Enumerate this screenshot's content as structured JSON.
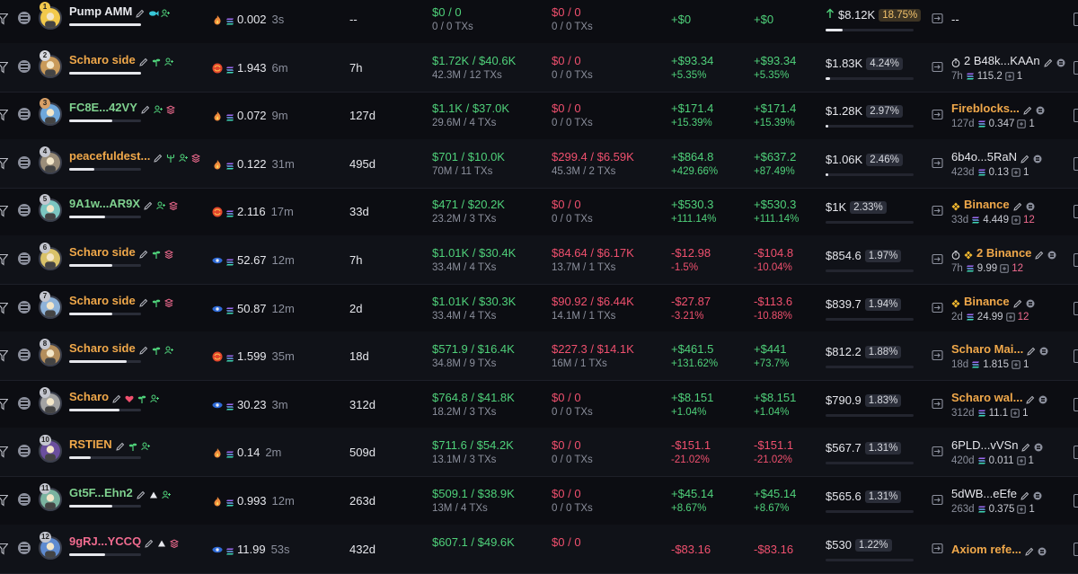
{
  "colors": {
    "background": "#0c0d12",
    "alt_row": "#101218",
    "profit": "#4fd17a",
    "loss": "#f0506e",
    "name_orange": "#f0a84a",
    "name_green": "#7fd18f",
    "highlight_pill": "#f2c26b"
  },
  "rows": [
    {
      "rank": "1",
      "rank_style": "gold",
      "name": "Pump AMM",
      "name_color": "white",
      "name_progress": 1.0,
      "icons": [
        "edit-icon",
        "fish-icon",
        "user-add-icon"
      ],
      "balance": "0.002",
      "balance_age": "3s",
      "source_icon": "fire-icon",
      "held": "--",
      "bought_usd": "$0",
      "bought_total": "0",
      "bought_sub": "0 / 0 TXs",
      "bought_color": "green",
      "sold_usd": "$0",
      "sold_total": "0",
      "sold_sub": "0 / 0 TXs",
      "pnl": "+$0",
      "pnl_pct": "",
      "pnl_color": "green",
      "upnl": "+$0",
      "upnl_pct": "",
      "upnl_color": "green",
      "remaining": "$8.12K",
      "remaining_pct": "18.75%",
      "remaining_highlight": true,
      "remaining_fill": 0.19,
      "remaining_up_arrow": true,
      "funding_name": "--",
      "funding_style": "white",
      "funding_age": "",
      "funding_amount": "",
      "funding_count": ""
    },
    {
      "rank": "2",
      "rank_style": "silver",
      "name": "Scharo side",
      "name_color": "orange",
      "name_progress": 1.0,
      "icons": [
        "edit-icon",
        "plant-icon",
        "user-add-icon"
      ],
      "balance": "1.943",
      "balance_age": "6m",
      "source_icon": "swap-icon",
      "held": "7h",
      "bought_usd": "$1.72K",
      "bought_total": "$40.6K",
      "bought_sub": "42.3M / 12 TXs",
      "sold_usd": "$0",
      "sold_total": "0",
      "sold_sub": "0 / 0 TXs",
      "pnl": "+$93.34",
      "pnl_pct": "+5.35%",
      "pnl_color": "green",
      "upnl": "+$93.34",
      "upnl_pct": "+5.35%",
      "upnl_color": "green",
      "remaining": "$1.83K",
      "remaining_pct": "4.24%",
      "remaining_highlight": false,
      "remaining_fill": 0.05,
      "funding_name": "2 B48k...KAAn",
      "funding_style": "white",
      "funding_timer": true,
      "funding_age": "7h",
      "funding_amount": "115.2",
      "funding_count": "1"
    },
    {
      "rank": "3",
      "rank_style": "bronze",
      "name": "FC8E...42VY",
      "name_color": "green",
      "name_progress": 0.6,
      "icons": [
        "edit-icon",
        "user-add-icon",
        "stack-icon"
      ],
      "balance": "0.072",
      "balance_age": "9m",
      "source_icon": "fire-icon",
      "held": "127d",
      "bought_usd": "$1.1K",
      "bought_total": "$37.0K",
      "bought_sub": "29.6M / 4 TXs",
      "sold_usd": "$0",
      "sold_total": "0",
      "sold_sub": "0 / 0 TXs",
      "pnl": "+$171.4",
      "pnl_pct": "+15.39%",
      "pnl_color": "green",
      "upnl": "+$171.4",
      "upnl_pct": "+15.39%",
      "upnl_color": "green",
      "remaining": "$1.28K",
      "remaining_pct": "2.97%",
      "remaining_highlight": false,
      "remaining_fill": 0.03,
      "funding_name": "Fireblocks...",
      "funding_style": "orange",
      "funding_age": "127d",
      "funding_amount": "0.347",
      "funding_count": "1"
    },
    {
      "rank": "4",
      "rank_style": "",
      "name": "peacefuldest...",
      "name_color": "orange",
      "name_progress": 0.35,
      "icons": [
        "edit-icon",
        "trident-icon",
        "user-add-icon",
        "stack-icon"
      ],
      "balance": "0.122",
      "balance_age": "31m",
      "source_icon": "fire-icon",
      "held": "495d",
      "bought_usd": "$701",
      "bought_total": "$10.0K",
      "bought_sub": "70M / 11 TXs",
      "sold_usd": "$299.4",
      "sold_total": "$6.59K",
      "sold_sub": "45.3M / 2 TXs",
      "sold_active": true,
      "pnl": "+$864.8",
      "pnl_pct": "+429.66%",
      "pnl_color": "green",
      "upnl": "+$637.2",
      "upnl_pct": "+87.49%",
      "upnl_color": "green",
      "remaining": "$1.06K",
      "remaining_pct": "2.46%",
      "remaining_highlight": false,
      "remaining_fill": 0.03,
      "funding_name": "6b4o...5RaN",
      "funding_style": "white",
      "funding_age": "423d",
      "funding_amount": "0.13",
      "funding_count": "1"
    },
    {
      "rank": "5",
      "rank_style": "",
      "name": "9A1w...AR9X",
      "name_color": "green",
      "name_progress": 0.5,
      "icons": [
        "edit-icon",
        "user-add-icon",
        "stack-icon"
      ],
      "balance": "2.116",
      "balance_age": "17m",
      "source_icon": "swap-icon",
      "held": "33d",
      "bought_usd": "$471",
      "bought_total": "$20.2K",
      "bought_sub": "23.2M / 3 TXs",
      "sold_usd": "$0",
      "sold_total": "0",
      "sold_sub": "0 / 0 TXs",
      "pnl": "+$530.3",
      "pnl_pct": "+111.14%",
      "pnl_color": "green",
      "upnl": "+$530.3",
      "upnl_pct": "+111.14%",
      "upnl_color": "green",
      "remaining": "$1K",
      "remaining_pct": "2.33%",
      "remaining_highlight": false,
      "remaining_fill": 0.0,
      "funding_name": "Binance",
      "funding_style": "orange",
      "funding_binance": true,
      "funding_age": "33d",
      "funding_amount": "4.449",
      "funding_count": "12",
      "funding_count_pink": true
    },
    {
      "rank": "6",
      "rank_style": "",
      "name": "Scharo side",
      "name_color": "orange",
      "name_progress": 0.6,
      "icons": [
        "edit-icon",
        "plant-icon",
        "stack-icon"
      ],
      "balance": "52.67",
      "balance_age": "12m",
      "source_icon": "eye-icon",
      "held": "7h",
      "bought_usd": "$1.01K",
      "bought_total": "$30.4K",
      "bought_sub": "33.4M / 4 TXs",
      "sold_usd": "$84.64",
      "sold_total": "$6.17K",
      "sold_sub": "13.7M / 1 TXs",
      "sold_active": true,
      "pnl": "-$12.98",
      "pnl_pct": "-1.5%",
      "pnl_color": "red",
      "upnl": "-$104.8",
      "upnl_pct": "-10.04%",
      "upnl_color": "red",
      "remaining": "$854.6",
      "remaining_pct": "1.97%",
      "remaining_highlight": false,
      "remaining_fill": 0.0,
      "funding_name": "2 Binance",
      "funding_style": "orange",
      "funding_timer": true,
      "funding_binance": true,
      "funding_age": "7h",
      "funding_amount": "9.99",
      "funding_count": "12",
      "funding_count_pink": true
    },
    {
      "rank": "7",
      "rank_style": "",
      "name": "Scharo side",
      "name_color": "orange",
      "name_progress": 0.6,
      "icons": [
        "edit-icon",
        "plant-icon",
        "stack-icon"
      ],
      "balance": "50.87",
      "balance_age": "12m",
      "source_icon": "eye-icon",
      "held": "2d",
      "bought_usd": "$1.01K",
      "bought_total": "$30.3K",
      "bought_sub": "33.4M / 4 TXs",
      "sold_usd": "$90.92",
      "sold_total": "$6.44K",
      "sold_sub": "14.1M / 1 TXs",
      "sold_active": true,
      "pnl": "-$27.87",
      "pnl_pct": "-3.21%",
      "pnl_color": "red",
      "upnl": "-$113.6",
      "upnl_pct": "-10.88%",
      "upnl_color": "red",
      "remaining": "$839.7",
      "remaining_pct": "1.94%",
      "remaining_highlight": false,
      "remaining_fill": 0.0,
      "funding_name": "Binance",
      "funding_style": "orange",
      "funding_binance": true,
      "funding_age": "2d",
      "funding_amount": "24.99",
      "funding_count": "12",
      "funding_count_pink": true
    },
    {
      "rank": "8",
      "rank_style": "",
      "name": "Scharo side",
      "name_color": "orange",
      "name_progress": 0.8,
      "icons": [
        "edit-icon",
        "plant-icon",
        "user-add-icon"
      ],
      "balance": "1.599",
      "balance_age": "35m",
      "source_icon": "swap-icon",
      "held": "18d",
      "bought_usd": "$571.9",
      "bought_total": "$16.4K",
      "bought_sub": "34.8M / 9 TXs",
      "sold_usd": "$227.3",
      "sold_total": "$14.1K",
      "sold_sub": "16M / 1 TXs",
      "sold_active": true,
      "pnl": "+$461.5",
      "pnl_pct": "+131.62%",
      "pnl_color": "green",
      "upnl": "+$441",
      "upnl_pct": "+73.7%",
      "upnl_color": "green",
      "remaining": "$812.2",
      "remaining_pct": "1.88%",
      "remaining_highlight": false,
      "remaining_fill": 0.0,
      "funding_name": "Scharo Mai...",
      "funding_style": "orange",
      "funding_age": "18d",
      "funding_amount": "1.815",
      "funding_count": "1"
    },
    {
      "rank": "9",
      "rank_style": "",
      "name": "Scharo",
      "name_color": "orange",
      "name_progress": 0.7,
      "icons": [
        "edit-icon",
        "heart-icon",
        "plant-icon",
        "user-add-icon"
      ],
      "balance": "30.23",
      "balance_age": "3m",
      "source_icon": "eye-icon",
      "held": "312d",
      "bought_usd": "$764.8",
      "bought_total": "$41.8K",
      "bought_sub": "18.2M / 3 TXs",
      "sold_usd": "$0",
      "sold_total": "0",
      "sold_sub": "0 / 0 TXs",
      "pnl": "+$8.151",
      "pnl_pct": "+1.04%",
      "pnl_color": "green",
      "upnl": "+$8.151",
      "upnl_pct": "+1.04%",
      "upnl_color": "green",
      "remaining": "$790.9",
      "remaining_pct": "1.83%",
      "remaining_highlight": false,
      "remaining_fill": 0.0,
      "funding_name": "Scharo wal...",
      "funding_style": "orange",
      "funding_age": "312d",
      "funding_amount": "11.1",
      "funding_count": "1"
    },
    {
      "rank": "10",
      "rank_style": "",
      "name": "RSTIEN",
      "name_color": "orange",
      "name_progress": 0.3,
      "icons": [
        "edit-icon",
        "plant-icon",
        "user-add-icon"
      ],
      "balance": "0.14",
      "balance_age": "2m",
      "source_icon": "fire-icon",
      "held": "509d",
      "bought_usd": "$711.6",
      "bought_total": "$54.2K",
      "bought_sub": "13.1M / 3 TXs",
      "sold_usd": "$0",
      "sold_total": "0",
      "sold_sub": "0 / 0 TXs",
      "pnl": "-$151.1",
      "pnl_pct": "-21.02%",
      "pnl_color": "red",
      "upnl": "-$151.1",
      "upnl_pct": "-21.02%",
      "upnl_color": "red",
      "remaining": "$567.7",
      "remaining_pct": "1.31%",
      "remaining_highlight": false,
      "remaining_fill": 0.0,
      "funding_name": "6PLD...vVSn",
      "funding_style": "white",
      "funding_age": "420d",
      "funding_amount": "0.011",
      "funding_count": "1"
    },
    {
      "rank": "11",
      "rank_style": "",
      "name": "Gt5F...Ehn2",
      "name_color": "green",
      "name_progress": 0.6,
      "icons": [
        "edit-icon",
        "triangle-icon",
        "user-add-icon"
      ],
      "balance": "0.993",
      "balance_age": "12m",
      "source_icon": "fire-icon",
      "held": "263d",
      "bought_usd": "$509.1",
      "bought_total": "$38.9K",
      "bought_sub": "13M / 4 TXs",
      "sold_usd": "$0",
      "sold_total": "0",
      "sold_sub": "0 / 0 TXs",
      "pnl": "+$45.14",
      "pnl_pct": "+8.67%",
      "pnl_color": "green",
      "upnl": "+$45.14",
      "upnl_pct": "+8.67%",
      "upnl_color": "green",
      "remaining": "$565.6",
      "remaining_pct": "1.31%",
      "remaining_highlight": false,
      "remaining_fill": 0.0,
      "funding_name": "5dWB...eEfe",
      "funding_style": "white",
      "funding_age": "263d",
      "funding_amount": "0.375",
      "funding_count": "1"
    },
    {
      "rank": "12",
      "rank_style": "",
      "name": "9gRJ...YCCQ",
      "name_color": "pink",
      "name_progress": 0.5,
      "icons": [
        "edit-icon",
        "triangle-icon",
        "stack-icon"
      ],
      "balance": "11.99",
      "balance_age": "53s",
      "source_icon": "eye-icon",
      "held": "432d",
      "bought_usd": "$607.1",
      "bought_total": "$49.6K",
      "bought_sub": "",
      "sold_usd": "$0",
      "sold_total": "0",
      "sold_sub": "",
      "pnl": "-$83.16",
      "pnl_pct": "",
      "pnl_color": "red",
      "upnl": "-$83.16",
      "upnl_pct": "",
      "upnl_color": "red",
      "remaining": "$530",
      "remaining_pct": "1.22%",
      "remaining_highlight": false,
      "remaining_fill": 0.0,
      "funding_name": "Axiom refe...",
      "funding_style": "orange",
      "funding_age": "",
      "funding_amount": "",
      "funding_count": ""
    }
  ]
}
